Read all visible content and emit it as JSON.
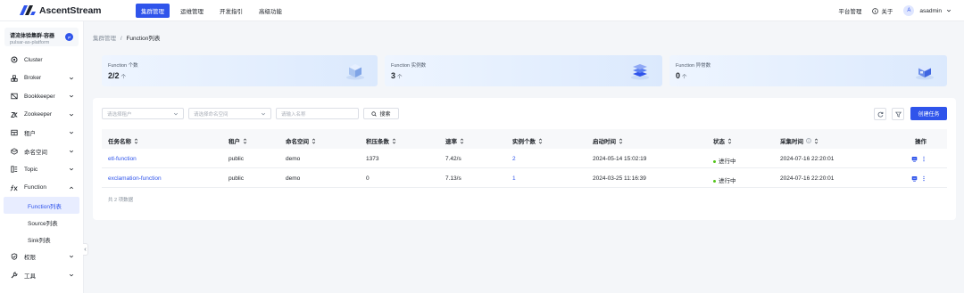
{
  "brand": {
    "name": "AscentStream"
  },
  "topnav": [
    {
      "label": "集群管理",
      "active": true
    },
    {
      "label": "运维管理",
      "active": false
    },
    {
      "label": "开发指引",
      "active": false
    },
    {
      "label": "高级功能",
      "active": false
    }
  ],
  "topright": {
    "platform": "平台管理",
    "about": "关于",
    "avatar_letter": "A",
    "user": "asadmin"
  },
  "cluster": {
    "name": "请流体验集群-容器",
    "sub": "pulsar-as-platform",
    "badge": "pf"
  },
  "sidebar": {
    "items": [
      {
        "label": "Cluster",
        "icon": "cluster-icon"
      },
      {
        "label": "Broker",
        "icon": "broker-icon"
      },
      {
        "label": "Bookkeeper",
        "icon": "bookkeeper-icon"
      },
      {
        "label": "Zookeeper",
        "icon": "zookeeper-icon"
      },
      {
        "label": "租户",
        "icon": "tenant-icon"
      },
      {
        "label": "命名空间",
        "icon": "namespace-icon"
      },
      {
        "label": "Topic",
        "icon": "topic-icon"
      },
      {
        "label": "Function",
        "icon": "function-icon"
      }
    ],
    "sub": [
      {
        "label": "Function列表",
        "active": true
      },
      {
        "label": "Source列表",
        "active": false
      },
      {
        "label": "Sink列表",
        "active": false
      }
    ],
    "bottom": [
      {
        "label": "权限",
        "icon": "permission-icon"
      },
      {
        "label": "工具",
        "icon": "tool-icon"
      }
    ]
  },
  "breadcrumb": {
    "parent": "集群管理",
    "sep": "/",
    "current": "Function列表"
  },
  "stats": [
    {
      "label": "Function 个数",
      "value": "2/2",
      "unit": "个"
    },
    {
      "label": "Function 实例数",
      "value": "3",
      "unit": "个"
    },
    {
      "label": "Function 异常数",
      "value": "0",
      "unit": "个"
    }
  ],
  "filters": {
    "tenant_placeholder": "请选择租户",
    "namespace_placeholder": "请选择命名空间",
    "name_placeholder": "请输入名称",
    "search_label": "搜索",
    "create_label": "创建任务"
  },
  "table": {
    "headers": [
      "任务名称",
      "租户",
      "命名空间",
      "积压条数",
      "速率",
      "实例个数",
      "启动时间",
      "状态",
      "采集时间",
      "操作"
    ],
    "rows": [
      [
        "etl-function",
        "public",
        "demo",
        "1373",
        "7.42/s",
        "2",
        "2024-05-14 15:02:19",
        "进行中",
        "2024-07-16 22:20:01"
      ],
      [
        "exclamation-function",
        "public",
        "demo",
        "0",
        "7.13/s",
        "1",
        "2024-03-25 11:16:39",
        "进行中",
        "2024-07-16 22:20:01"
      ]
    ],
    "total": "共 2 项数据"
  },
  "colors": {
    "primary": "#2f54eb",
    "status_running": "#52c41a"
  }
}
